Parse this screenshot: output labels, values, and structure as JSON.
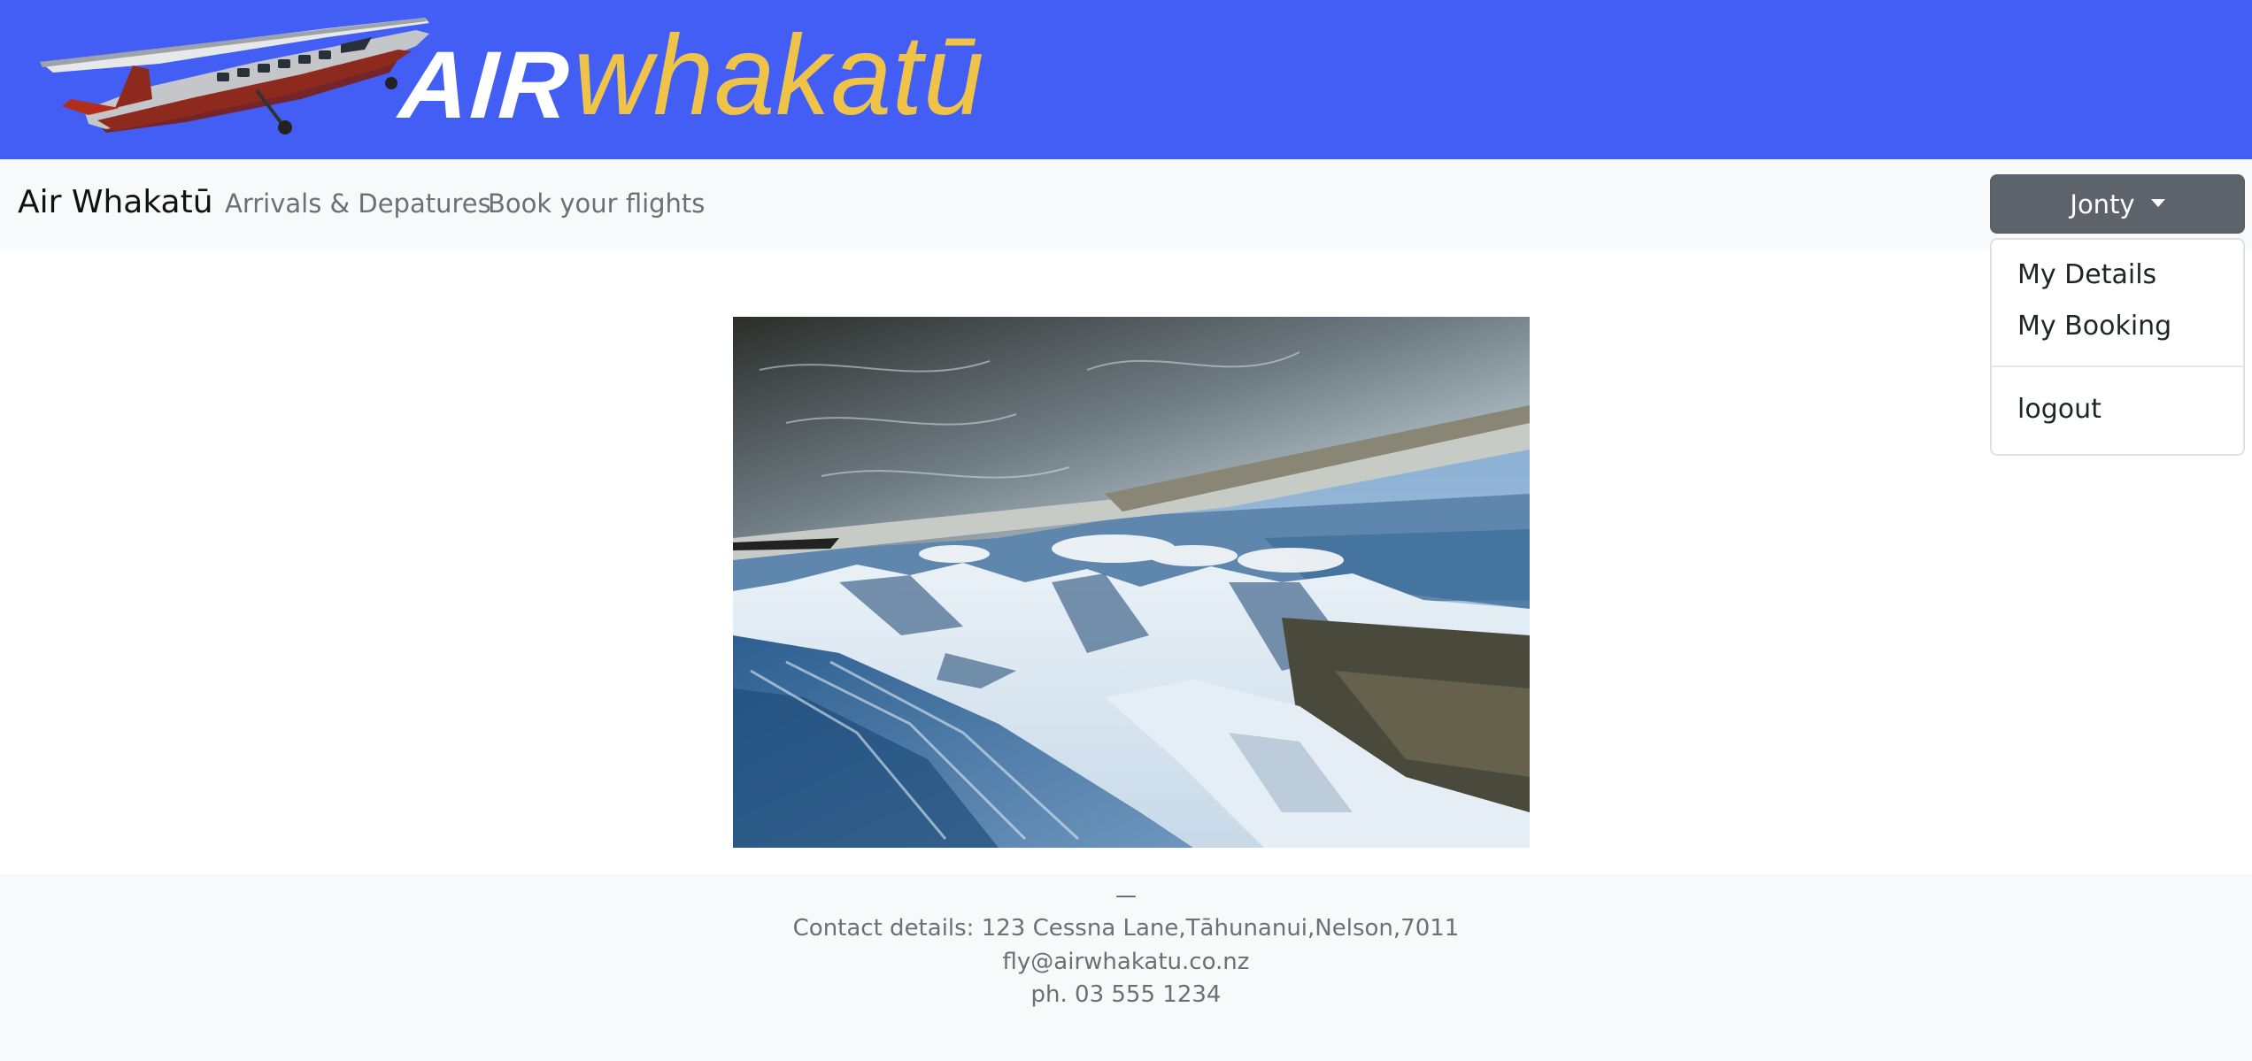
{
  "banner": {
    "logo_air": "AIR",
    "logo_whakatu": "whakatū",
    "plane_icon": "airplane-icon",
    "colors": {
      "background": "#435ef5",
      "air_text": "#ffffff",
      "whakatu_text": "#efc248"
    }
  },
  "navbar": {
    "brand": "Air Whakatū",
    "links": [
      "Arrivals & Depatures",
      "Book your flights"
    ],
    "user_button": "Jonty"
  },
  "dropdown": {
    "items": [
      "My Details",
      "My Booking"
    ],
    "logout": "logout"
  },
  "main": {
    "image_icon": "aerial-mountain-photo"
  },
  "footer": {
    "dash": "—",
    "address": "Contact details: 123 Cessna Lane,Tāhunanui,Nelson,7011",
    "email": "fly@airwhakatu.co.nz",
    "phone": "ph. 03 555 1234"
  }
}
